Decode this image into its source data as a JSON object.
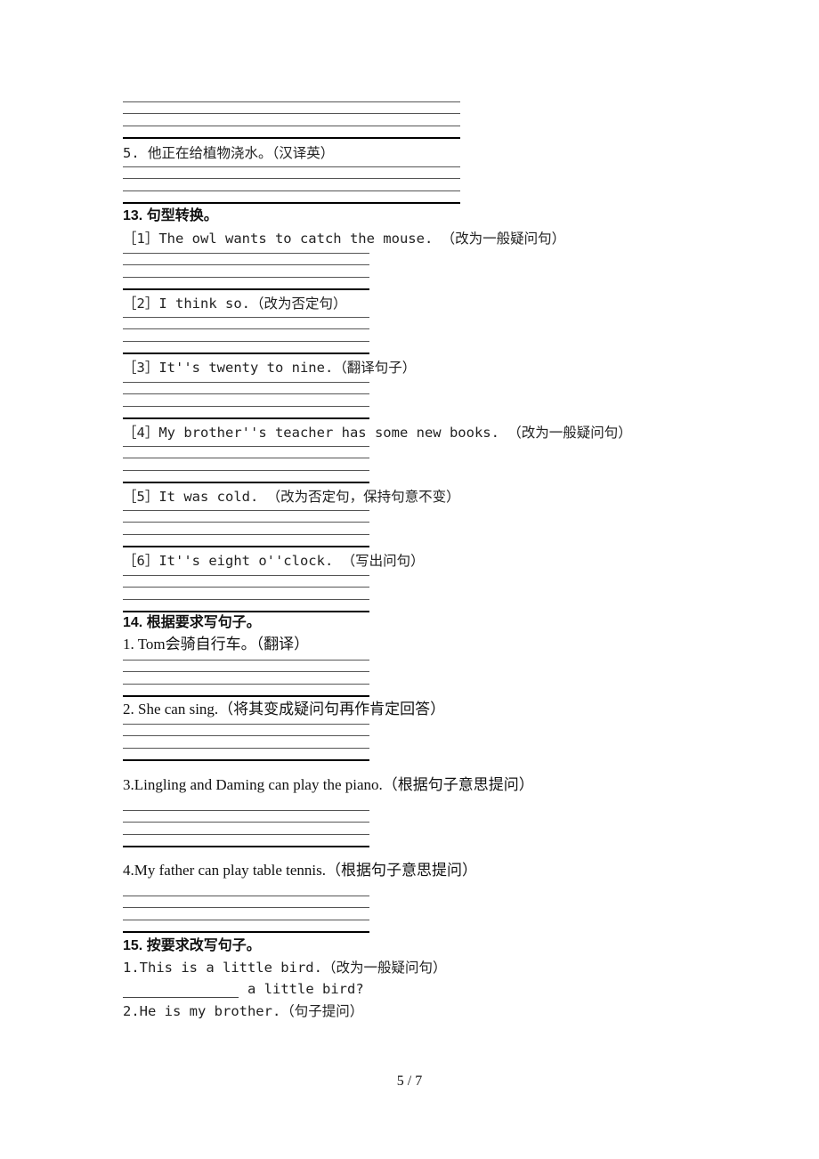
{
  "q5": "5. 他正在给植物浇水。（汉译英）",
  "s13": {
    "heading": "13. 句型转换。",
    "items": [
      "［1］The owl wants to catch the mouse. （改为一般疑问句）",
      "［2］I think so.（改为否定句）",
      "［3］It''s twenty to nine.（翻译句子）",
      "［4］My brother''s teacher has some new books. （改为一般疑问句）",
      "［5］It was cold. （改为否定句，保持句意不变）",
      "［6］It''s eight o''clock.  （写出问句）"
    ]
  },
  "s14": {
    "heading": "14. 根据要求写句子。",
    "items": [
      "1. Tom会骑自行车。（翻译）",
      "2. She can sing.（将其变成疑问句再作肯定回答）",
      "3.Lingling and Daming can play the piano.（根据句子意思提问）",
      "4.My father can play table tennis.（根据句子意思提问）"
    ]
  },
  "s15": {
    "heading": "15. 按要求改写句子。",
    "item1": "1.This is a little bird.（改为一般疑问句）",
    "item1_fill": "a little bird?",
    "item2": "2.He is my brother.（句子提问）"
  },
  "footer": {
    "page": "5 / 7"
  }
}
